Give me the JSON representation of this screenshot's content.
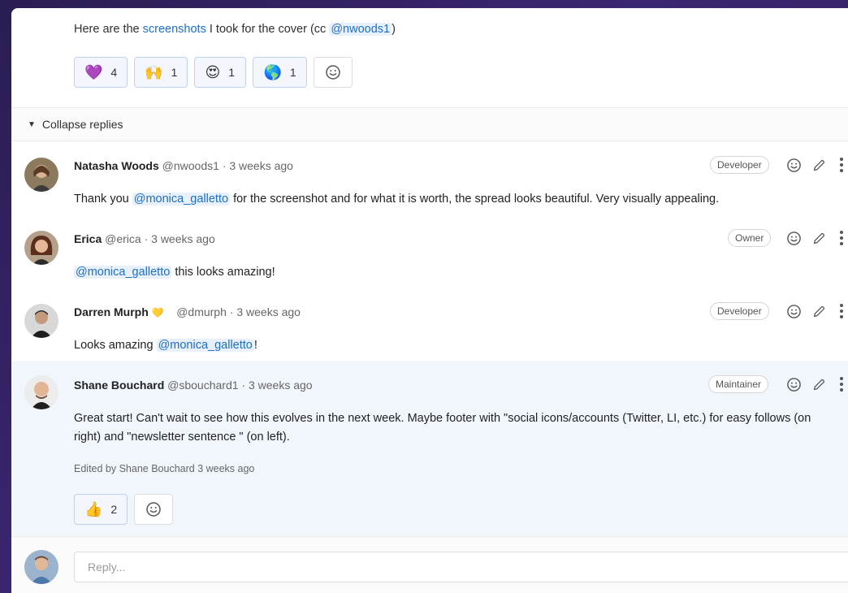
{
  "top_comment": {
    "text_before": "Here are the ",
    "link_text": "screenshots",
    "text_middle": " I took for the cover (cc ",
    "mention": "@nwoods1",
    "text_after": ")",
    "reactions": [
      {
        "emoji": "💜",
        "icon": "purple-heart-icon",
        "count": "4"
      },
      {
        "emoji": "🙌",
        "icon": "raised-hands-icon",
        "count": "1"
      },
      {
        "emoji": "😍",
        "icon": "heart-eyes-icon",
        "count": "1"
      },
      {
        "emoji": "🌎",
        "icon": "globe-icon",
        "count": "1"
      }
    ]
  },
  "collapse": {
    "label": "Collapse replies"
  },
  "notes": [
    {
      "author": "Natasha Woods",
      "handle": "@nwoods1",
      "time": "· 3 weeks ago",
      "role": "Developer",
      "body_before": "Thank you ",
      "mention": "@monica_galletto",
      "body_after": " for the screenshot and for what it is worth, the spread looks beautiful. Very visually appealing."
    },
    {
      "author": "Erica",
      "handle": "@erica",
      "time": "· 3 weeks ago",
      "role": "Owner",
      "body_before": "",
      "mention": "@monica_galletto",
      "body_after": " this looks amazing!"
    },
    {
      "author": "Darren Murph",
      "status_emoji": "💛",
      "handle": "@dmurph",
      "time": "· 3 weeks ago",
      "role": "Developer",
      "body_before": "Looks amazing ",
      "mention": "@monica_galletto",
      "body_after": "!"
    },
    {
      "author": "Shane Bouchard",
      "handle": "@sbouchard1",
      "time": "· 3 weeks ago",
      "role": "Maintainer",
      "body_line1": "Great start! Can't wait to see how this evolves in the next week. Maybe footer with \"social icons/accounts (Twitter, LI, etc.) for easy follows (on",
      "body_line2": "right) and \"newsletter sentence \" (on left).",
      "edited": "Edited by Shane Bouchard 3 weeks ago",
      "reaction": {
        "emoji": "👍",
        "icon": "thumbs-up-icon",
        "count": "2"
      }
    }
  ],
  "reply": {
    "placeholder": "Reply..."
  }
}
